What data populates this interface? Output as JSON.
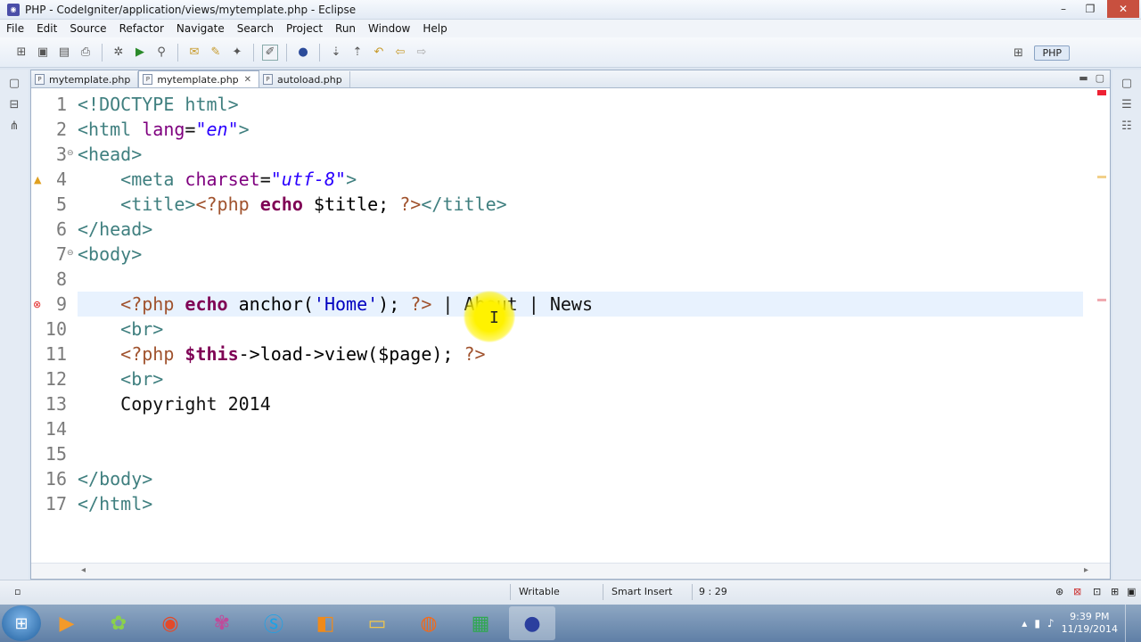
{
  "window": {
    "title": "PHP - CodeIgniter/application/views/mytemplate.php - Eclipse"
  },
  "menu": [
    "File",
    "Edit",
    "Source",
    "Refactor",
    "Navigate",
    "Search",
    "Project",
    "Run",
    "Window",
    "Help"
  ],
  "perspective": {
    "label": "PHP"
  },
  "tabs": [
    {
      "label": "mytemplate.php",
      "active": false
    },
    {
      "label": "mytemplate.php",
      "active": true
    },
    {
      "label": "autoload.php",
      "active": false
    }
  ],
  "code": {
    "lines": [
      {
        "num": "1",
        "tokens": [
          {
            "c": "tag",
            "t": "<!DOCTYPE html>"
          }
        ]
      },
      {
        "num": "2",
        "tokens": [
          {
            "c": "tag",
            "t": "<html "
          },
          {
            "c": "attr",
            "t": "lang"
          },
          {
            "c": "plain",
            "t": "="
          },
          {
            "c": "str",
            "t": "\"en\""
          },
          {
            "c": "tag",
            "t": ">"
          }
        ]
      },
      {
        "num": "3",
        "fold": true,
        "tokens": [
          {
            "c": "tag",
            "t": "<head>"
          }
        ]
      },
      {
        "num": "4",
        "tokens": [
          {
            "c": "plain",
            "t": "    "
          },
          {
            "c": "tag",
            "t": "<meta "
          },
          {
            "c": "attr",
            "t": "charset"
          },
          {
            "c": "plain",
            "t": "="
          },
          {
            "c": "str",
            "t": "\"utf-8\""
          },
          {
            "c": "tag",
            "t": ">"
          }
        ]
      },
      {
        "num": "5",
        "tokens": [
          {
            "c": "plain",
            "t": "    "
          },
          {
            "c": "tag",
            "t": "<title>"
          },
          {
            "c": "php",
            "t": "<?php "
          },
          {
            "c": "kw",
            "t": "echo"
          },
          {
            "c": "var",
            "t": " $title; "
          },
          {
            "c": "php",
            "t": "?>"
          },
          {
            "c": "tag",
            "t": "</title>"
          }
        ]
      },
      {
        "num": "6",
        "tokens": [
          {
            "c": "tag",
            "t": "</head>"
          }
        ]
      },
      {
        "num": "7",
        "fold": true,
        "tokens": [
          {
            "c": "tag",
            "t": "<body>"
          }
        ]
      },
      {
        "num": "8",
        "tokens": []
      },
      {
        "num": "9",
        "current": true,
        "tokens": [
          {
            "c": "plain",
            "t": "    "
          },
          {
            "c": "php",
            "t": "<?php "
          },
          {
            "c": "kw",
            "t": "echo"
          },
          {
            "c": "var",
            "t": " anchor("
          },
          {
            "c": "sq",
            "t": "'Home'"
          },
          {
            "c": "var",
            "t": "); "
          },
          {
            "c": "php",
            "t": "?>"
          },
          {
            "c": "plain",
            "t": " | About | News"
          }
        ]
      },
      {
        "num": "10",
        "tokens": [
          {
            "c": "plain",
            "t": "    "
          },
          {
            "c": "tag",
            "t": "<br>"
          }
        ]
      },
      {
        "num": "11",
        "tokens": [
          {
            "c": "plain",
            "t": "    "
          },
          {
            "c": "php",
            "t": "<?php "
          },
          {
            "c": "kw",
            "t": "$this"
          },
          {
            "c": "var",
            "t": "->load->view($page); "
          },
          {
            "c": "php",
            "t": "?>"
          }
        ]
      },
      {
        "num": "12",
        "tokens": [
          {
            "c": "plain",
            "t": "    "
          },
          {
            "c": "tag",
            "t": "<br>"
          }
        ]
      },
      {
        "num": "13",
        "tokens": [
          {
            "c": "plain",
            "t": "    Copyright 2014"
          }
        ]
      },
      {
        "num": "14",
        "tokens": []
      },
      {
        "num": "15",
        "tokens": []
      },
      {
        "num": "16",
        "tokens": [
          {
            "c": "tag",
            "t": "</body>"
          }
        ]
      },
      {
        "num": "17",
        "tokens": [
          {
            "c": "tag",
            "t": "</html>"
          }
        ]
      }
    ]
  },
  "status": {
    "writable": "Writable",
    "insert_mode": "Smart Insert",
    "position": "9 : 29"
  },
  "clock": {
    "time": "9:39 PM",
    "date": "11/19/2014"
  },
  "colors": {
    "tag": "#3f7f7f",
    "attr": "#7f007f",
    "string": "#2a00ff",
    "keyword": "#7f0055",
    "php": "#a0522d",
    "current_line": "#e8f2fe"
  }
}
